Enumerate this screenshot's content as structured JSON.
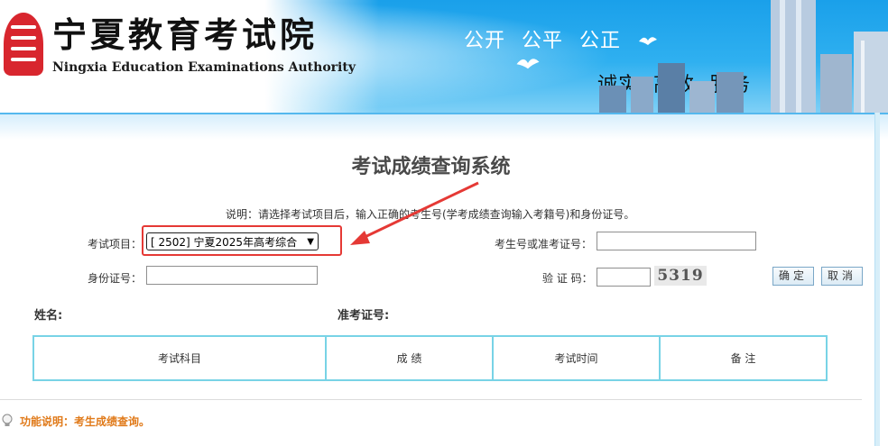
{
  "header": {
    "logo_cn": "宁夏教育考试院",
    "logo_en": "Ningxia Education Examinations Authority",
    "slogan_top": "公开 公平 公正",
    "slogan_bottom": "诚实 高效 服务"
  },
  "page": {
    "title": "考试成绩查询系统",
    "notice": "说明：请选择考试项目后，输入正确的考生号(学考成绩查询输入考籍号)和身份证号。"
  },
  "form": {
    "exam_label": "考试项目：",
    "exam_selected": "[ 2502] 宁夏2025年高考综合",
    "candidate_label": "考生号或准考证号：",
    "candidate_value": "",
    "id_label": "身份证号：",
    "id_value": "",
    "captcha_label": "验 证 码：",
    "captcha_value": "",
    "captcha_image_text": "5319",
    "confirm_button": "确定",
    "cancel_button": "取消"
  },
  "result": {
    "name_label": "姓名:",
    "ticket_label": "准考证号:",
    "columns": [
      "考试科目",
      "成 绩",
      "考试时间",
      "备 注"
    ]
  },
  "footer": {
    "function_note": "功能说明：考生成绩查询。"
  },
  "colors": {
    "banner_blue": "#1aa0ea",
    "highlight_red": "#e53935",
    "table_border": "#78d3e6",
    "note_orange": "#e07a1a"
  }
}
